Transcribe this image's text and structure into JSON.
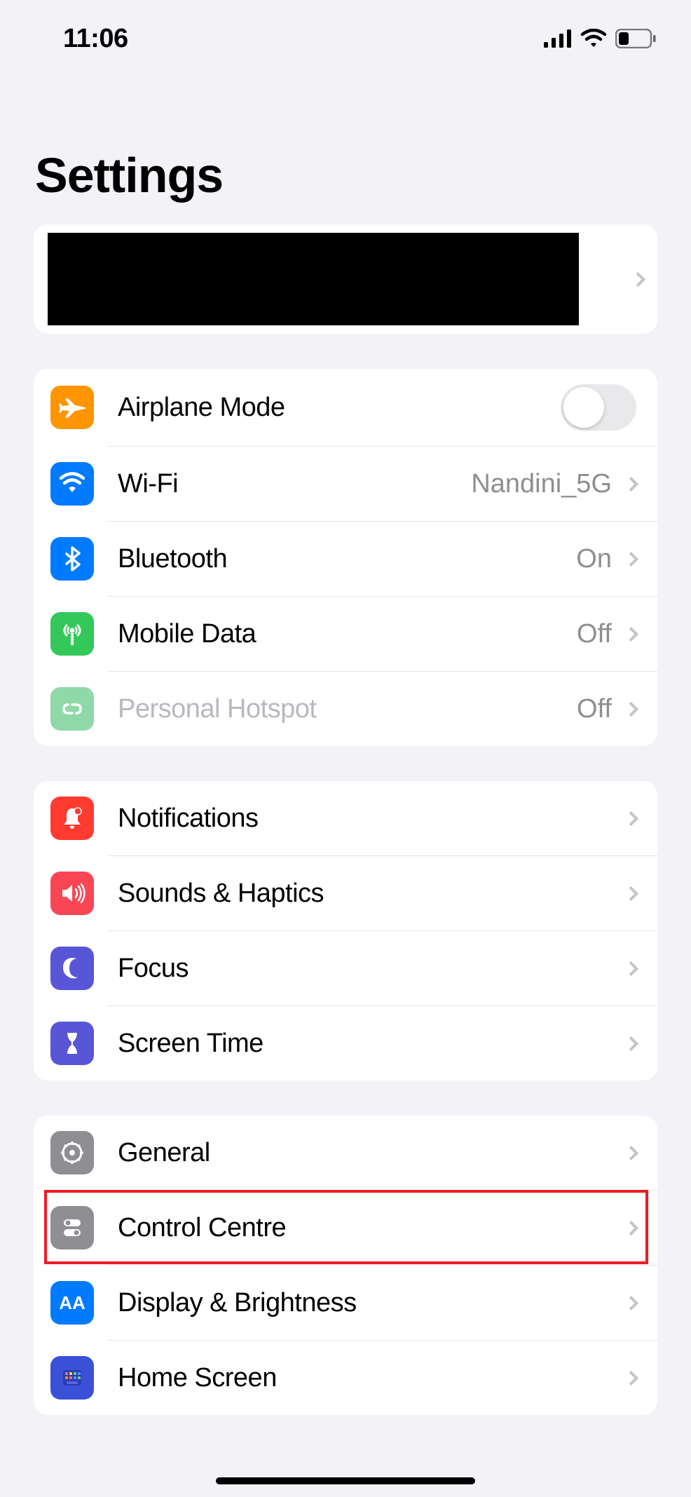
{
  "status": {
    "time": "11:06"
  },
  "title": "Settings",
  "groups": [
    {
      "rows": [
        {
          "label": "Airplane Mode",
          "value": "",
          "toggle": true
        },
        {
          "label": "Wi-Fi",
          "value": "Nandini_5G"
        },
        {
          "label": "Bluetooth",
          "value": "On"
        },
        {
          "label": "Mobile Data",
          "value": "Off"
        },
        {
          "label": "Personal Hotspot",
          "value": "Off",
          "disabled": true
        }
      ]
    },
    {
      "rows": [
        {
          "label": "Notifications"
        },
        {
          "label": "Sounds & Haptics"
        },
        {
          "label": "Focus"
        },
        {
          "label": "Screen Time"
        }
      ]
    },
    {
      "rows": [
        {
          "label": "General"
        },
        {
          "label": "Control Centre"
        },
        {
          "label": "Display & Brightness"
        },
        {
          "label": "Home Screen"
        }
      ]
    }
  ]
}
